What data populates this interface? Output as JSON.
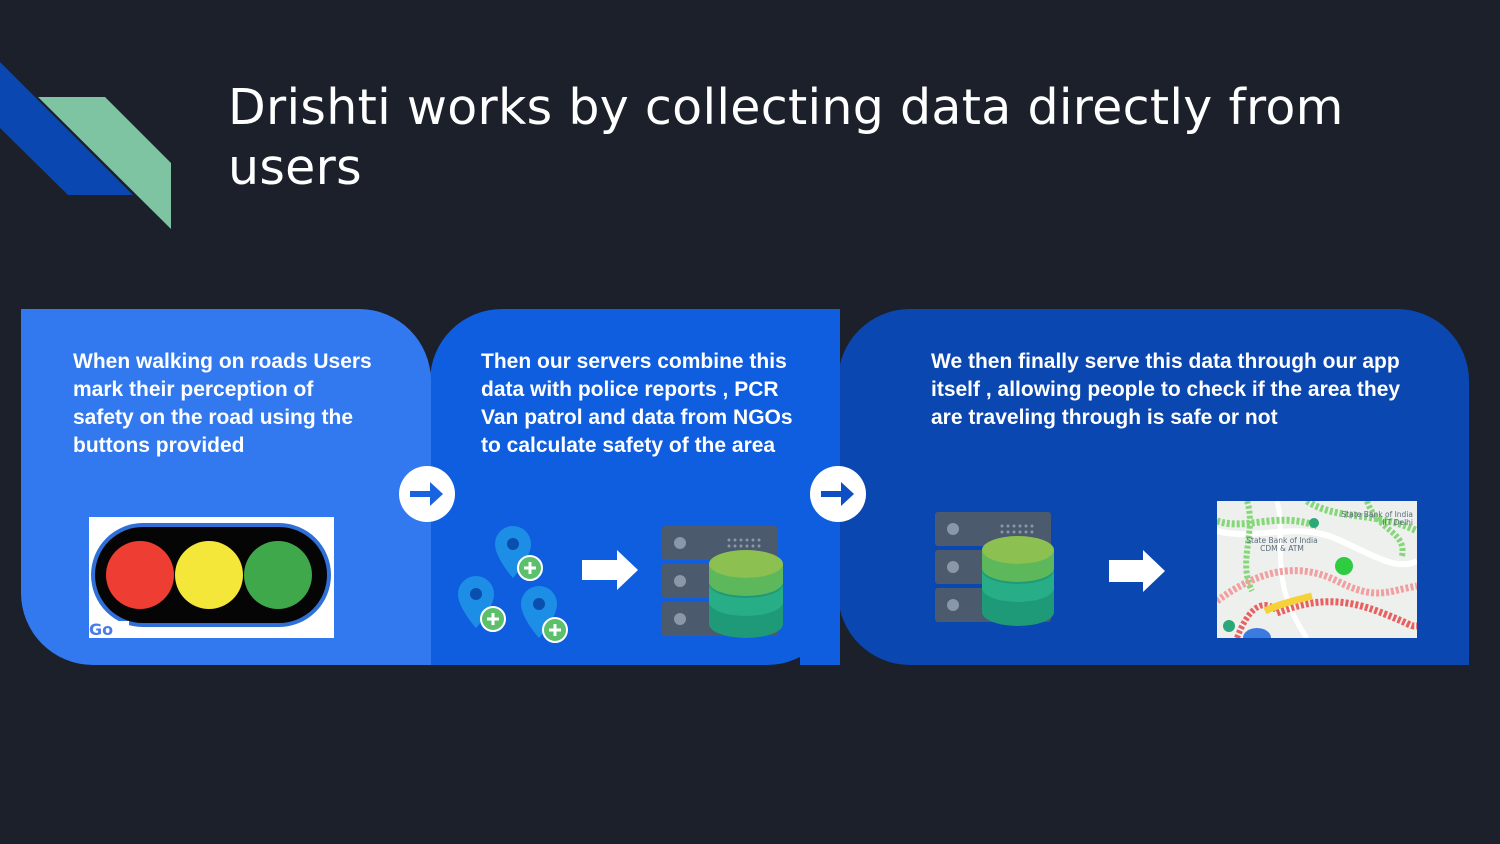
{
  "slide": {
    "title": "Drishti works by collecting data directly from users",
    "colors": {
      "background": "#1b202b",
      "panel1": "#3279f0",
      "panel2": "#0f5ee0",
      "panel3": "#0b47b0",
      "accent_green": "#7fc4a2",
      "accent_blue": "#0b47b0"
    }
  },
  "steps": [
    {
      "text": "When walking on roads Users mark their perception of safety on the road using the buttons provided",
      "graphic": "traffic-light-image"
    },
    {
      "text": "Then our servers combine this data with police reports , PCR Van patrol and data from NGOs to calculate safety of the area",
      "graphic": "location-pins-to-database"
    },
    {
      "text": "We then finally serve this data through our app itself , allowing people to check if the area they are traveling through is safe or not",
      "graphic": "database-to-map"
    }
  ],
  "icons": [
    "arrow-right-circle-icon",
    "location-pin-icon",
    "plus-icon",
    "server-icon",
    "database-icon",
    "right-arrow-icon",
    "map-icon"
  ],
  "map": {
    "labels": [
      "State Bank of India IIT Delhi",
      "State Bank of India CDM & ATM"
    ]
  }
}
